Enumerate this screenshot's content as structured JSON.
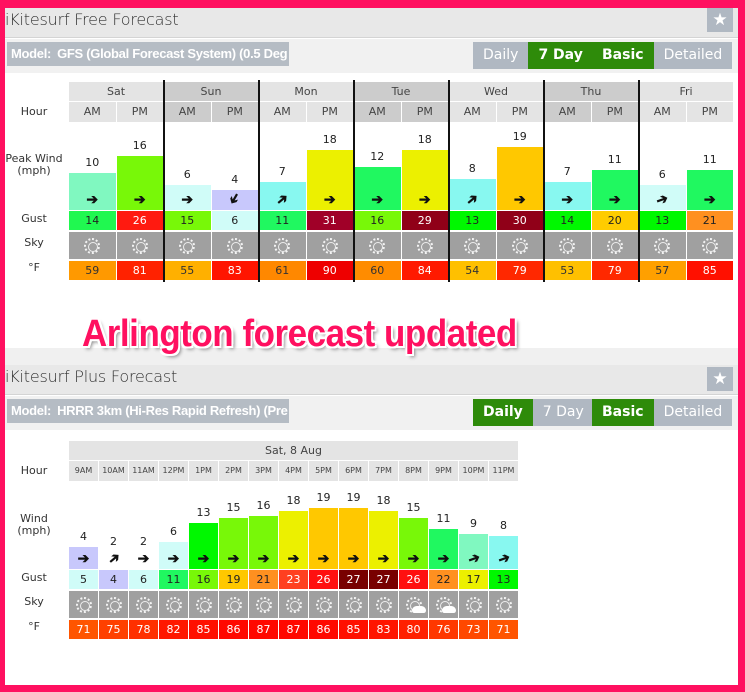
{
  "free": {
    "title": "iKitesurf Free Forecast",
    "model_label": "Model:",
    "model_value": "GFS (Global Forecast System) (0.5 Deg",
    "view_toggle": [
      {
        "label": "Daily",
        "active": false
      },
      {
        "label": "7 Day",
        "active": true
      }
    ],
    "detail_toggle": [
      {
        "label": "Basic",
        "active": true
      },
      {
        "label": "Detailed",
        "active": false
      }
    ],
    "row_labels": {
      "hour": "Hour",
      "wind": "Peak Wind\n(mph)",
      "gust": "Gust",
      "sky": "Sky",
      "temp": "°F"
    },
    "days": [
      "Sat",
      "Sun",
      "Mon",
      "Tue",
      "Wed",
      "Thu",
      "Fri"
    ],
    "columns": [
      {
        "hour": "AM",
        "wind": 10,
        "wind_color": "#80f8c0",
        "dir": "E",
        "gust": 14,
        "gust_color": "#20f850",
        "sky": "sunny",
        "temp": 59,
        "temp_color": "#ff9900"
      },
      {
        "hour": "PM",
        "wind": 16,
        "wind_color": "#78f808",
        "dir": "E",
        "gust": 26,
        "gust_color": "#ff1a10",
        "sky": "sunny",
        "temp": 81,
        "temp_color": "#ff2200"
      },
      {
        "hour": "AM",
        "wind": 6,
        "wind_color": "#d0fcf8",
        "dir": "E",
        "gust": 15,
        "gust_color": "#78f808",
        "sky": "sunny",
        "temp": 55,
        "temp_color": "#ffb000"
      },
      {
        "hour": "PM",
        "wind": 4,
        "wind_color": "#c8c8fc",
        "dir": "SW",
        "gust": 6,
        "gust_color": "#d0fcf8",
        "sky": "sunny",
        "temp": 83,
        "temp_color": "#ff1500"
      },
      {
        "hour": "AM",
        "wind": 7,
        "wind_color": "#88f8f0",
        "dir": "NE",
        "gust": 11,
        "gust_color": "#20f860",
        "sky": "sunny",
        "temp": 61,
        "temp_color": "#ff8800"
      },
      {
        "hour": "PM",
        "wind": 18,
        "wind_color": "#ecf000",
        "dir": "E",
        "gust": 31,
        "gust_color": "#a00028",
        "sky": "sunny",
        "temp": 90,
        "temp_color": "#ee0000"
      },
      {
        "hour": "AM",
        "wind": 12,
        "wind_color": "#20f860",
        "dir": "E",
        "gust": 16,
        "gust_color": "#78f808",
        "sky": "sunny",
        "temp": 60,
        "temp_color": "#ff8c00"
      },
      {
        "hour": "PM",
        "wind": 18,
        "wind_color": "#ecf000",
        "dir": "E",
        "gust": 29,
        "gust_color": "#900018",
        "sky": "sunny",
        "temp": 84,
        "temp_color": "#ff1a00"
      },
      {
        "hour": "AM",
        "wind": 8,
        "wind_color": "#88f8f0",
        "dir": "NE",
        "gust": 13,
        "gust_color": "#00f800",
        "sky": "sunny",
        "temp": 54,
        "temp_color": "#ffc000"
      },
      {
        "hour": "PM",
        "wind": 19,
        "wind_color": "#ffc800",
        "dir": "E",
        "gust": 30,
        "gust_color": "#900018",
        "sky": "sunny",
        "temp": 79,
        "temp_color": "#ff2800"
      },
      {
        "hour": "AM",
        "wind": 7,
        "wind_color": "#88f8f0",
        "dir": "E",
        "gust": 14,
        "gust_color": "#00f800",
        "sky": "sunny",
        "temp": 53,
        "temp_color": "#ffc000"
      },
      {
        "hour": "PM",
        "wind": 11,
        "wind_color": "#20f860",
        "dir": "E",
        "gust": 20,
        "gust_color": "#ffcc00",
        "sky": "sunny",
        "temp": 79,
        "temp_color": "#ff2800"
      },
      {
        "hour": "AM",
        "wind": 6,
        "wind_color": "#d0fcf8",
        "dir": "ENE",
        "gust": 13,
        "gust_color": "#00f800",
        "sky": "sunny",
        "temp": 57,
        "temp_color": "#ffa000"
      },
      {
        "hour": "PM",
        "wind": 11,
        "wind_color": "#20f860",
        "dir": "E",
        "gust": 21,
        "gust_color": "#ff9020",
        "sky": "sunny",
        "temp": 85,
        "temp_color": "#ff1000"
      }
    ]
  },
  "banner": "Arlington forecast updated",
  "plus": {
    "title": "iKitesurf Plus Forecast",
    "model_label": "Model:",
    "model_value": "HRRR 3km (Hi-Res Rapid Refresh) (Pre",
    "view_toggle": [
      {
        "label": "Daily",
        "active": true
      },
      {
        "label": "7 Day",
        "active": false
      }
    ],
    "detail_toggle": [
      {
        "label": "Basic",
        "active": true
      },
      {
        "label": "Detailed",
        "active": false
      }
    ],
    "row_labels": {
      "hour": "Hour",
      "wind": "Wind\n(mph)",
      "gust": "Gust",
      "sky": "Sky",
      "temp": "°F"
    },
    "date": "Sat, 8 Aug",
    "columns": [
      {
        "hour": "9AM",
        "wind": 4,
        "wind_color": "#c8c8fc",
        "dir": "E",
        "gust": 5,
        "gust_color": "#d0fcf8",
        "sky": "sunny",
        "temp": 71,
        "temp_color": "#ff5500"
      },
      {
        "hour": "10AM",
        "wind": 2,
        "wind_color": "#ffffff",
        "dir": "NE",
        "gust": 4,
        "gust_color": "#c8c8fc",
        "sky": "sunny",
        "temp": 75,
        "temp_color": "#ff4000"
      },
      {
        "hour": "11AM",
        "wind": 2,
        "wind_color": "#ffffff",
        "dir": "E",
        "gust": 6,
        "gust_color": "#d0fcf8",
        "sky": "sunny",
        "temp": 78,
        "temp_color": "#ff3000"
      },
      {
        "hour": "12PM",
        "wind": 6,
        "wind_color": "#d0fcf8",
        "dir": "E",
        "gust": 11,
        "gust_color": "#20f860",
        "sky": "sunny",
        "temp": 82,
        "temp_color": "#ff1800"
      },
      {
        "hour": "1PM",
        "wind": 13,
        "wind_color": "#00f800",
        "dir": "E",
        "gust": 16,
        "gust_color": "#78f808",
        "sky": "sunny",
        "temp": 85,
        "temp_color": "#ff1000"
      },
      {
        "hour": "2PM",
        "wind": 15,
        "wind_color": "#78f808",
        "dir": "E",
        "gust": 19,
        "gust_color": "#ffc800",
        "sky": "sunny",
        "temp": 86,
        "temp_color": "#ff0800"
      },
      {
        "hour": "3PM",
        "wind": 16,
        "wind_color": "#78f808",
        "dir": "E",
        "gust": 21,
        "gust_color": "#ff9020",
        "sky": "sunny",
        "temp": 87,
        "temp_color": "#ff0800"
      },
      {
        "hour": "4PM",
        "wind": 18,
        "wind_color": "#ecf000",
        "dir": "E",
        "gust": 23,
        "gust_color": "#ff4020",
        "sky": "sunny",
        "temp": 87,
        "temp_color": "#ff0800"
      },
      {
        "hour": "5PM",
        "wind": 19,
        "wind_color": "#ffc800",
        "dir": "E",
        "gust": 26,
        "gust_color": "#ff1010",
        "sky": "sunny",
        "temp": 86,
        "temp_color": "#ff0800"
      },
      {
        "hour": "6PM",
        "wind": 19,
        "wind_color": "#ffc800",
        "dir": "E",
        "gust": 27,
        "gust_color": "#780000",
        "sky": "sunny",
        "temp": 85,
        "temp_color": "#ff1000"
      },
      {
        "hour": "7PM",
        "wind": 18,
        "wind_color": "#ecf000",
        "dir": "E",
        "gust": 27,
        "gust_color": "#780000",
        "sky": "sunny",
        "temp": 83,
        "temp_color": "#ff1500"
      },
      {
        "hour": "8PM",
        "wind": 15,
        "wind_color": "#78f808",
        "dir": "E",
        "gust": 26,
        "gust_color": "#ff1010",
        "sky": "partly-cloudy",
        "temp": 80,
        "temp_color": "#ff2000"
      },
      {
        "hour": "9PM",
        "wind": 11,
        "wind_color": "#20f860",
        "dir": "E",
        "gust": 22,
        "gust_color": "#ff9020",
        "sky": "partly-cloudy",
        "temp": 76,
        "temp_color": "#ff3800"
      },
      {
        "hour": "10PM",
        "wind": 9,
        "wind_color": "#80f8c0",
        "dir": "ENE",
        "gust": 17,
        "gust_color": "#ecf000",
        "sky": "sunny",
        "temp": 73,
        "temp_color": "#ff4800"
      },
      {
        "hour": "11PM",
        "wind": 8,
        "wind_color": "#88f8f0",
        "dir": "ENE",
        "gust": 13,
        "gust_color": "#00f800",
        "sky": "sunny",
        "temp": 71,
        "temp_color": "#ff5500"
      }
    ]
  }
}
